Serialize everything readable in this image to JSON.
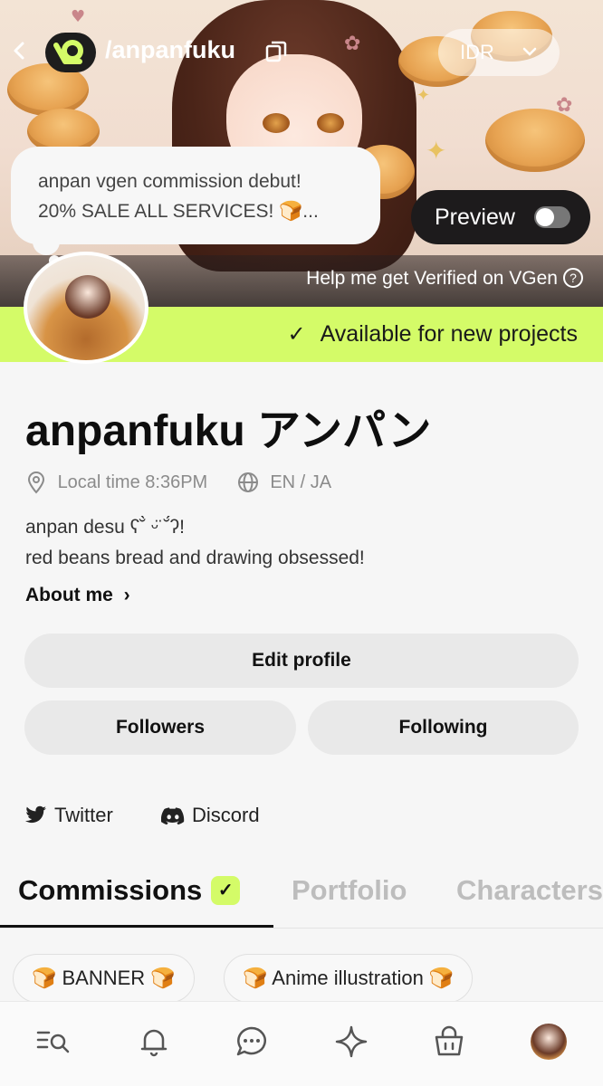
{
  "header": {
    "handle": "/anpanfuku",
    "currency": "IDR"
  },
  "banner": {
    "bubble_line1": "anpan vgen commission debut!",
    "bubble_line2": "20% SALE ALL SERVICES! 🍞...",
    "preview_label": "Preview",
    "preview_on": false,
    "verify_text": "Help me get Verified on VGen",
    "available_text": "Available for new projects"
  },
  "profile": {
    "name": "anpanfuku アンパン",
    "local_time": "Local time 8:36PM",
    "languages": "EN / JA",
    "bio_line1": "anpan desu ʕ˘̀ ᵕ̈ ˘́ʔ!",
    "bio_line2": "red beans bread and drawing obsessed!",
    "about_label": "About me"
  },
  "actions": {
    "edit_profile": "Edit profile",
    "followers": "Followers",
    "following": "Following"
  },
  "socials": [
    {
      "label": "Twitter",
      "icon": "twitter-icon"
    },
    {
      "label": "Discord",
      "icon": "discord-icon"
    }
  ],
  "tabs": [
    {
      "label": "Commissions",
      "active": true
    },
    {
      "label": "Portfolio",
      "active": false
    },
    {
      "label": "Characters",
      "active": false
    }
  ],
  "chips": [
    {
      "label": "🍞 BANNER 🍞"
    },
    {
      "label": "🍞 Anime illustration 🍞"
    }
  ],
  "bottom_nav": [
    "search-list-icon",
    "bell-icon",
    "chat-icon",
    "sparkle-icon",
    "bag-icon",
    "profile-avatar"
  ],
  "colors": {
    "accent": "#d4fb68",
    "dark": "#1d1b1c",
    "muted": "#8b8b8b"
  }
}
